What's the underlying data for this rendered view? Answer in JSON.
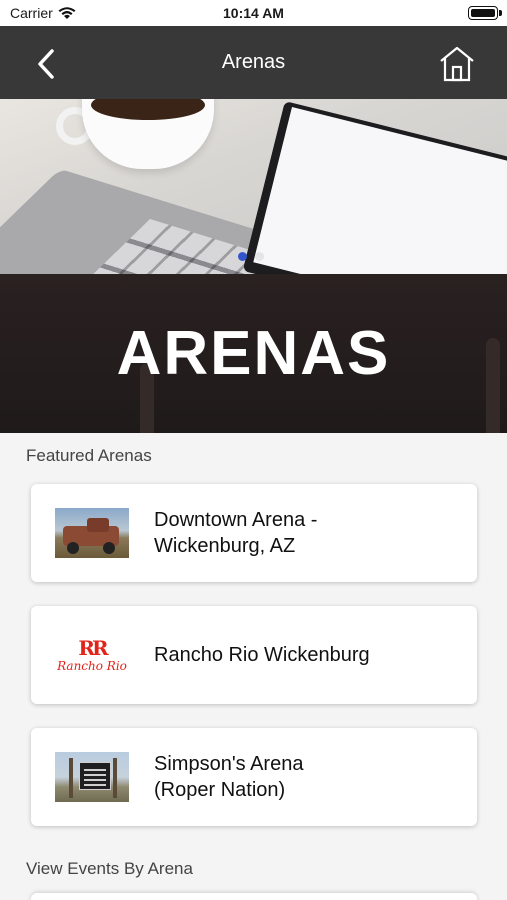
{
  "status_bar": {
    "carrier": "Carrier",
    "time": "10:14 AM"
  },
  "nav": {
    "title": "Arenas",
    "back_icon": "chevron-left-icon",
    "home_icon": "home-icon"
  },
  "hero": {
    "banner_title": "ARENAS",
    "carousel_total": 2,
    "carousel_active": 1
  },
  "featured": {
    "label": "Featured Arenas",
    "items": [
      {
        "name": "Downtown Arena -\nWickenburg, AZ",
        "thumbnail": "old-truck-photo"
      },
      {
        "name": "Rancho Rio Wickenburg",
        "thumbnail": "rancho-rio-logo",
        "logo_mark": "RR",
        "logo_script": "Rancho Rio"
      },
      {
        "name": "Simpson's Arena\n(Roper Nation)",
        "thumbnail": "arena-sign-photo"
      }
    ]
  },
  "events": {
    "label": "View Events By Arena"
  },
  "colors": {
    "nav_background": "#383838",
    "banner_background": "#231c1c",
    "carousel_active": "#3355cc",
    "logo_red": "#e2231a",
    "page_background": "#f4f4f4"
  }
}
